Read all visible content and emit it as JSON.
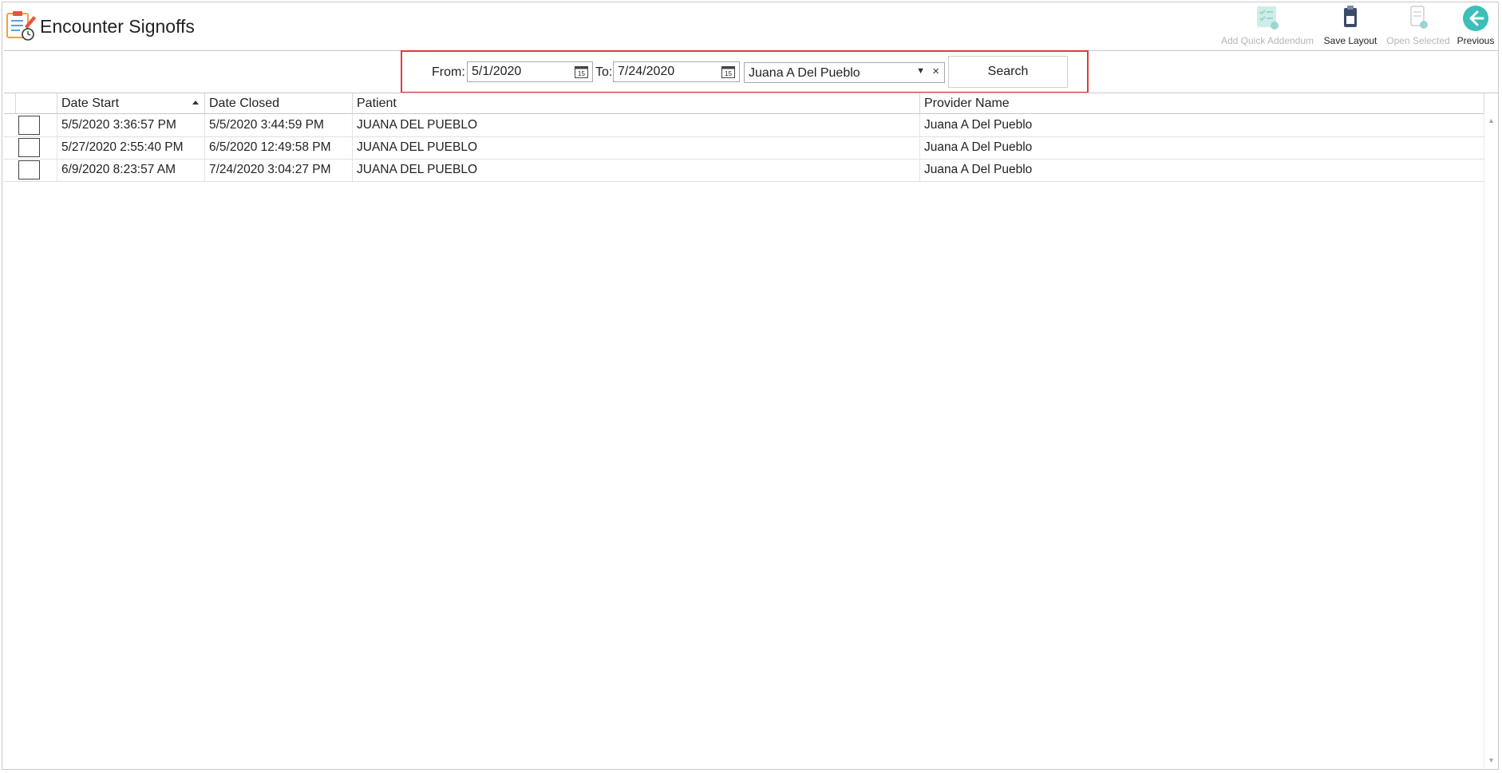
{
  "header": {
    "title": "Encounter Signoffs",
    "toolbar": [
      {
        "label": "Add Quick Addendum",
        "icon": "checklist-add-icon",
        "enabled": false
      },
      {
        "label": "Save Layout",
        "icon": "save-clipboard-icon",
        "enabled": true
      },
      {
        "label": "Open Selected",
        "icon": "document-add-icon",
        "enabled": false
      },
      {
        "label": "Previous",
        "icon": "arrow-left-circle-icon",
        "enabled": true
      }
    ]
  },
  "filter": {
    "from_label": "From:",
    "from_value": "5/1/2020",
    "to_label": "To:",
    "to_value": "7/24/2020",
    "provider_value": "Juana A Del Pueblo",
    "clear_symbol": "×",
    "search_label": "Search",
    "calendar_day": "15",
    "highlight_color": "#e23a3a"
  },
  "grid": {
    "columns": [
      "Date Start",
      "Date Closed",
      "Patient",
      "Provider Name"
    ],
    "sorted_column": "Date Start",
    "sort_direction": "ascending",
    "rows": [
      {
        "date_start": "5/5/2020 3:36:57 PM",
        "date_closed": "5/5/2020 3:44:59 PM",
        "patient": "JUANA DEL PUEBLO",
        "provider": "Juana A Del Pueblo"
      },
      {
        "date_start": "5/27/2020 2:55:40 PM",
        "date_closed": "6/5/2020 12:49:58 PM",
        "patient": "JUANA DEL PUEBLO",
        "provider": "Juana A Del Pueblo"
      },
      {
        "date_start": "6/9/2020 8:23:57 AM",
        "date_closed": "7/24/2020 3:04:27 PM",
        "patient": "JUANA DEL PUEBLO",
        "provider": "Juana A Del Pueblo"
      }
    ]
  },
  "colors": {
    "accent_teal": "#3bbfb8",
    "disabled_text": "#b6b6b6"
  }
}
